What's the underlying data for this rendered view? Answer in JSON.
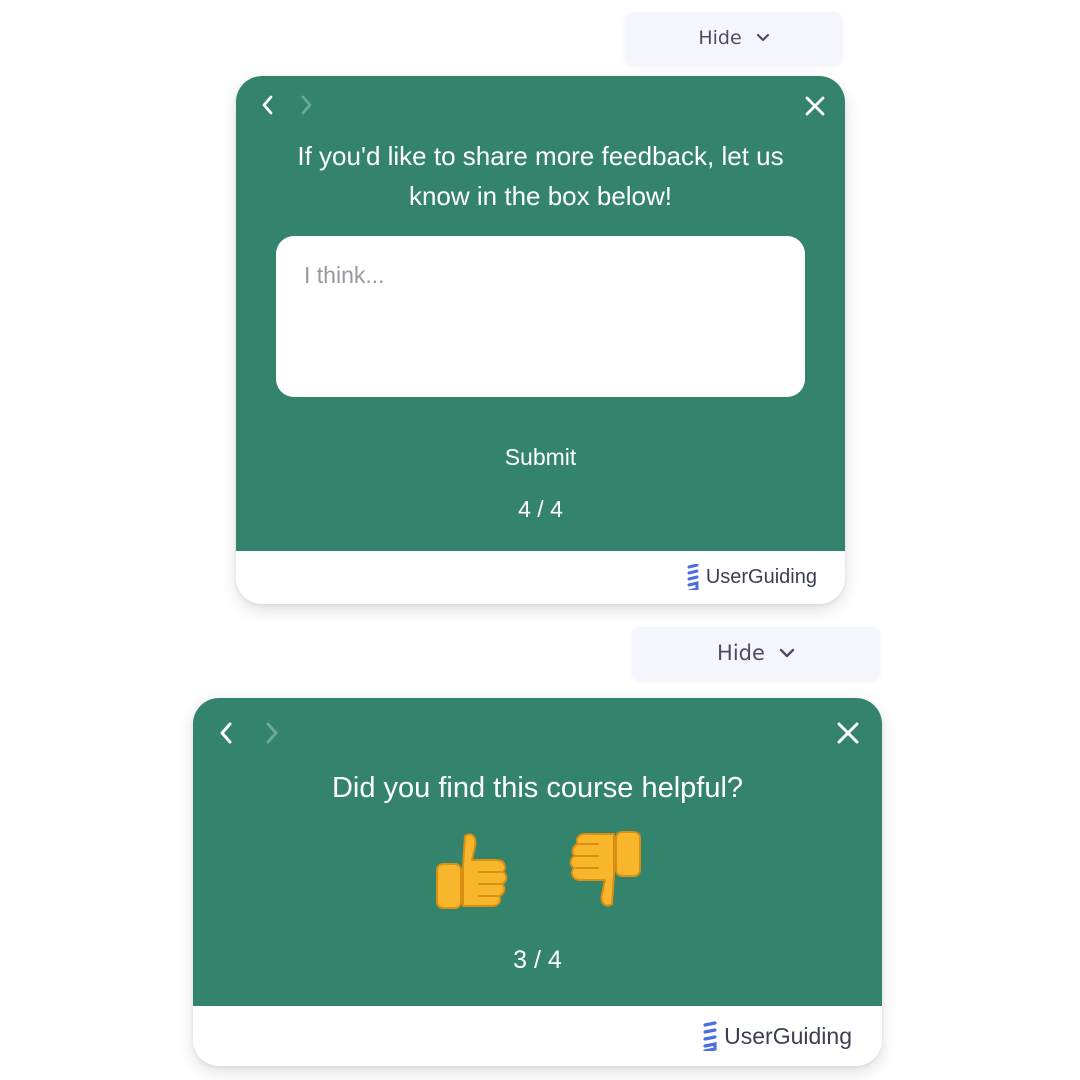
{
  "widget_top": {
    "hide_label": "Hide",
    "title": "If you'd like to share more feedback, let us know in the box below!",
    "textbox_placeholder": "I think...",
    "submit_label": "Submit",
    "step_counter": "4 / 4",
    "brand_name": "UserGuiding"
  },
  "widget_bottom": {
    "hide_label": "Hide",
    "title": "Did you find this course helpful?",
    "step_counter": "3 / 4",
    "brand_name": "UserGuiding",
    "reactions": [
      "thumbs-up",
      "thumbs-down"
    ]
  },
  "colors": {
    "card_body": "#33836d",
    "hide_button_bg": "#f5f5fd",
    "brand_icon": "#4a6fe3",
    "emoji_yellow": "#f8b62c"
  }
}
